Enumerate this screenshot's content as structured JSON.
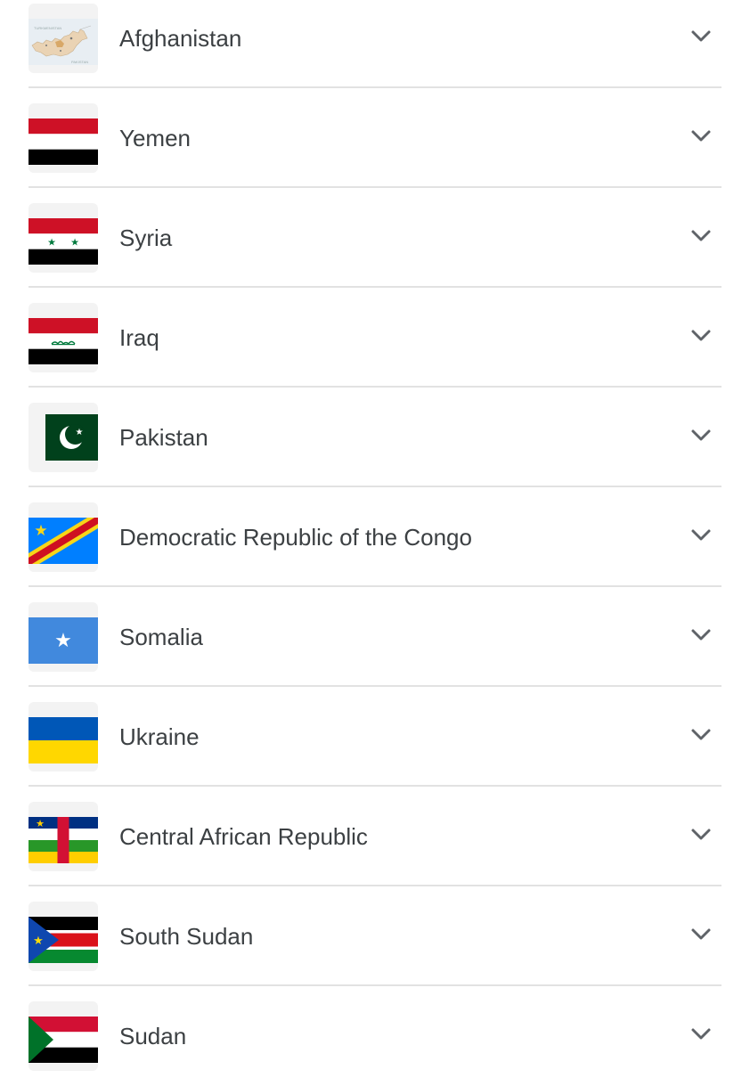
{
  "countries": [
    {
      "name": "Afghanistan",
      "flag_icon": "afghanistan-map-icon"
    },
    {
      "name": "Yemen",
      "flag_icon": "yemen-flag-icon"
    },
    {
      "name": "Syria",
      "flag_icon": "syria-flag-icon"
    },
    {
      "name": "Iraq",
      "flag_icon": "iraq-flag-icon"
    },
    {
      "name": "Pakistan",
      "flag_icon": "pakistan-flag-icon"
    },
    {
      "name": "Democratic Republic of the Congo",
      "flag_icon": "drc-flag-icon"
    },
    {
      "name": "Somalia",
      "flag_icon": "somalia-flag-icon"
    },
    {
      "name": "Ukraine",
      "flag_icon": "ukraine-flag-icon"
    },
    {
      "name": "Central African Republic",
      "flag_icon": "car-flag-icon"
    },
    {
      "name": "South Sudan",
      "flag_icon": "south-sudan-flag-icon"
    },
    {
      "name": "Sudan",
      "flag_icon": "sudan-flag-icon"
    }
  ],
  "colors": {
    "text": "#3c4043",
    "divider": "#e2e2e2",
    "chevron": "#5f6368",
    "thumb_bg": "#f3f3f3"
  }
}
